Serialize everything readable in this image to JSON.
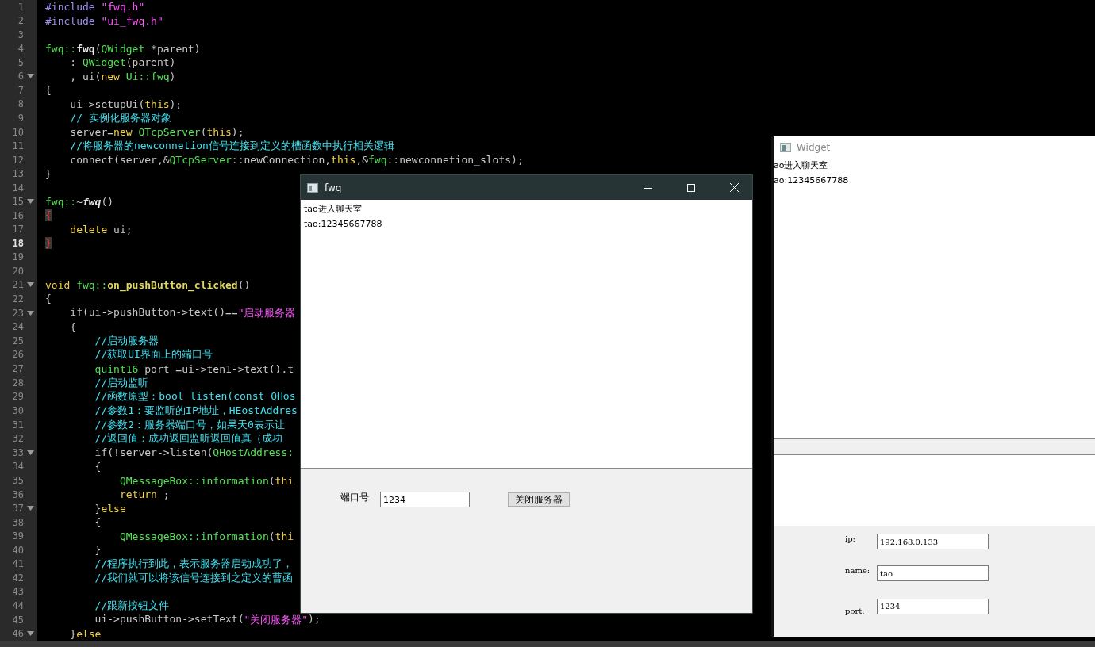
{
  "editor": {
    "lines": [
      {
        "number": "1",
        "fold": false,
        "current": false,
        "segments": [
          {
            "kind": "pre",
            "text": "#include "
          },
          {
            "kind": "str",
            "text": "\"fwq.h\""
          }
        ]
      },
      {
        "number": "2",
        "fold": false,
        "current": false,
        "segments": [
          {
            "kind": "pre",
            "text": "#include "
          },
          {
            "kind": "str",
            "text": "\"ui_fwq.h\""
          }
        ]
      },
      {
        "number": "3",
        "fold": false,
        "current": false
      },
      {
        "number": "4",
        "fold": false,
        "current": false,
        "segments": [
          {
            "kind": "type",
            "text": "fwq::"
          },
          {
            "kind": "def",
            "text": "fwq"
          },
          {
            "kind": "plain",
            "text": "("
          },
          {
            "kind": "type",
            "text": "QWidget"
          },
          {
            "kind": "plain",
            "text": " *parent)"
          }
        ]
      },
      {
        "number": "5",
        "fold": false,
        "current": false,
        "segments": [
          {
            "kind": "plain",
            "text": "    : "
          },
          {
            "kind": "type",
            "text": "QWidget"
          },
          {
            "kind": "plain",
            "text": "(parent)"
          }
        ]
      },
      {
        "number": "6",
        "fold": true,
        "current": false,
        "segments": [
          {
            "kind": "plain",
            "text": "    , ui("
          },
          {
            "kind": "kw",
            "text": "new "
          },
          {
            "kind": "type",
            "text": "Ui::fwq"
          },
          {
            "kind": "plain",
            "text": ")"
          }
        ]
      },
      {
        "number": "7",
        "fold": false,
        "current": false,
        "segments": [
          {
            "kind": "plain",
            "text": "{"
          }
        ]
      },
      {
        "number": "8",
        "fold": false,
        "current": false,
        "segments": [
          {
            "kind": "plain",
            "text": "    ui->setupUi("
          },
          {
            "kind": "kw",
            "text": "this"
          },
          {
            "kind": "plain",
            "text": ");"
          }
        ]
      },
      {
        "number": "9",
        "fold": false,
        "current": false,
        "segments": [
          {
            "kind": "comment",
            "text": "    // 实例化服务器对象"
          }
        ]
      },
      {
        "number": "10",
        "fold": false,
        "current": false,
        "segments": [
          {
            "kind": "plain",
            "text": "    server="
          },
          {
            "kind": "kw",
            "text": "new "
          },
          {
            "kind": "type",
            "text": "QTcpServer"
          },
          {
            "kind": "plain",
            "text": "("
          },
          {
            "kind": "kw",
            "text": "this"
          },
          {
            "kind": "plain",
            "text": ");"
          }
        ]
      },
      {
        "number": "11",
        "fold": false,
        "current": false,
        "segments": [
          {
            "kind": "comment",
            "text": "    //将服务器的newconnetion信号连接到定义的槽函数中执行相关逻辑"
          }
        ]
      },
      {
        "number": "12",
        "fold": false,
        "current": false,
        "segments": [
          {
            "kind": "plain",
            "text": "    connect(server,&"
          },
          {
            "kind": "type",
            "text": "QTcpServer"
          },
          {
            "kind": "plain",
            "text": "::newConnection,"
          },
          {
            "kind": "kw",
            "text": "this"
          },
          {
            "kind": "plain",
            "text": ",&"
          },
          {
            "kind": "type",
            "text": "fwq"
          },
          {
            "kind": "plain",
            "text": "::newconnetion_slots);"
          }
        ]
      },
      {
        "number": "13",
        "fold": false,
        "current": false,
        "segments": [
          {
            "kind": "plain",
            "text": "}"
          }
        ]
      },
      {
        "number": "14",
        "fold": false,
        "current": false
      },
      {
        "number": "15",
        "fold": true,
        "current": false,
        "segments": [
          {
            "kind": "type",
            "text": "fwq::"
          },
          {
            "kind": "plain",
            "text": "~"
          },
          {
            "kind": "defitalic",
            "text": "fwq"
          },
          {
            "kind": "plain",
            "text": "()"
          }
        ]
      },
      {
        "number": "16",
        "fold": false,
        "current": false,
        "segments": [
          {
            "kind": "match",
            "text": "{"
          }
        ]
      },
      {
        "number": "17",
        "fold": false,
        "current": false,
        "segments": [
          {
            "kind": "kw",
            "text": "    delete"
          },
          {
            "kind": "plain",
            "text": " ui;"
          }
        ]
      },
      {
        "number": "18",
        "fold": false,
        "current": true,
        "segments": [
          {
            "kind": "match",
            "text": "}"
          }
        ]
      },
      {
        "number": "19",
        "fold": false,
        "current": false
      },
      {
        "number": "20",
        "fold": false,
        "current": false
      },
      {
        "number": "21",
        "fold": true,
        "current": false,
        "segments": [
          {
            "kind": "kw",
            "text": "void "
          },
          {
            "kind": "type",
            "text": "fwq::"
          },
          {
            "kind": "method",
            "text": "on_pushButton_clicked"
          },
          {
            "kind": "plain",
            "text": "()"
          }
        ]
      },
      {
        "number": "22",
        "fold": false,
        "current": false,
        "segments": [
          {
            "kind": "plain",
            "text": "{"
          }
        ]
      },
      {
        "number": "23",
        "fold": true,
        "current": false,
        "segments": [
          {
            "kind": "plain",
            "text": "    if(ui->pushButton->text()=="
          },
          {
            "kind": "str",
            "text": "\"启动服务器"
          }
        ]
      },
      {
        "number": "24",
        "fold": false,
        "current": false,
        "segments": [
          {
            "kind": "plain",
            "text": "    {"
          }
        ]
      },
      {
        "number": "25",
        "fold": false,
        "current": false,
        "segments": [
          {
            "kind": "comment",
            "text": "        //启动服务器"
          }
        ]
      },
      {
        "number": "26",
        "fold": false,
        "current": false,
        "segments": [
          {
            "kind": "comment",
            "text": "        //获取UI界面上的端口号"
          }
        ]
      },
      {
        "number": "27",
        "fold": false,
        "current": false,
        "segments": [
          {
            "kind": "type",
            "text": "        quint16"
          },
          {
            "kind": "plain",
            "text": " port =ui->ten1->text().t"
          }
        ]
      },
      {
        "number": "28",
        "fold": false,
        "current": false,
        "segments": [
          {
            "kind": "comment",
            "text": "        //启动监听"
          }
        ]
      },
      {
        "number": "29",
        "fold": false,
        "current": false,
        "segments": [
          {
            "kind": "comment",
            "text": "        //函数原型：bool listen(const QHos"
          }
        ]
      },
      {
        "number": "30",
        "fold": false,
        "current": false,
        "segments": [
          {
            "kind": "comment",
            "text": "        //参数1：要监听的IP地址，HEostAddres"
          }
        ]
      },
      {
        "number": "31",
        "fold": false,
        "current": false,
        "segments": [
          {
            "kind": "comment",
            "text": "        //参数2：服务器端口号，如果天0表示让"
          }
        ]
      },
      {
        "number": "32",
        "fold": false,
        "current": false,
        "segments": [
          {
            "kind": "comment",
            "text": "        //返回值：成功返回监听返回值真（成功"
          }
        ]
      },
      {
        "number": "33",
        "fold": true,
        "current": false,
        "segments": [
          {
            "kind": "plain",
            "text": "        if(!server->listen("
          },
          {
            "kind": "type",
            "text": "QHostAddress:"
          }
        ]
      },
      {
        "number": "34",
        "fold": false,
        "current": false,
        "segments": [
          {
            "kind": "plain",
            "text": "        {"
          }
        ]
      },
      {
        "number": "35",
        "fold": false,
        "current": false,
        "segments": [
          {
            "kind": "type",
            "text": "            QMessageBox::information"
          },
          {
            "kind": "plain",
            "text": "("
          },
          {
            "kind": "kw",
            "text": "thi"
          }
        ]
      },
      {
        "number": "36",
        "fold": false,
        "current": false,
        "segments": [
          {
            "kind": "kw",
            "text": "            return"
          },
          {
            "kind": "plain",
            "text": " ;"
          }
        ]
      },
      {
        "number": "37",
        "fold": true,
        "current": false,
        "segments": [
          {
            "kind": "plain",
            "text": "        }"
          },
          {
            "kind": "kw",
            "text": "else"
          }
        ]
      },
      {
        "number": "38",
        "fold": false,
        "current": false,
        "segments": [
          {
            "kind": "plain",
            "text": "        {"
          }
        ]
      },
      {
        "number": "39",
        "fold": false,
        "current": false,
        "segments": [
          {
            "kind": "type",
            "text": "            QMessageBox::information"
          },
          {
            "kind": "plain",
            "text": "("
          },
          {
            "kind": "kw",
            "text": "thi"
          }
        ]
      },
      {
        "number": "40",
        "fold": false,
        "current": false,
        "segments": [
          {
            "kind": "plain",
            "text": "        }"
          }
        ]
      },
      {
        "number": "41",
        "fold": false,
        "current": false,
        "segments": [
          {
            "kind": "comment",
            "text": "        //程序执行到此，表示服务器启动成功了，"
          }
        ]
      },
      {
        "number": "42",
        "fold": false,
        "current": false,
        "segments": [
          {
            "kind": "comment",
            "text": "        //我们就可以将该信号连接到之定义的曹函"
          }
        ]
      },
      {
        "number": "43",
        "fold": false,
        "current": false
      },
      {
        "number": "44",
        "fold": false,
        "current": false,
        "segments": [
          {
            "kind": "comment",
            "text": "        //跟新按钮文件"
          }
        ]
      },
      {
        "number": "45",
        "fold": false,
        "current": false,
        "segments": [
          {
            "kind": "plain",
            "text": "        ui->pushButton->setText("
          },
          {
            "kind": "str",
            "text": "\"关闭服务器\""
          },
          {
            "kind": "plain",
            "text": ");"
          }
        ]
      },
      {
        "number": "46",
        "fold": true,
        "current": false,
        "segments": [
          {
            "kind": "plain",
            "text": "    }"
          },
          {
            "kind": "kw",
            "text": "else"
          }
        ]
      }
    ]
  },
  "fwq_window": {
    "title": "fwq",
    "messages": [
      "tao进入聊天室",
      "tao:12345667788"
    ],
    "port_label": "端口号",
    "port_value": "1234",
    "button": "关闭服务器"
  },
  "widget_window": {
    "title": "Widget",
    "messages": [
      "ao进入聊天室",
      "ao:12345667788"
    ],
    "fields": [
      {
        "label": "ip:",
        "value": "192.168.0.133"
      },
      {
        "label": "name:",
        "value": "tao"
      },
      {
        "label": "port:",
        "value": "1234"
      }
    ]
  }
}
